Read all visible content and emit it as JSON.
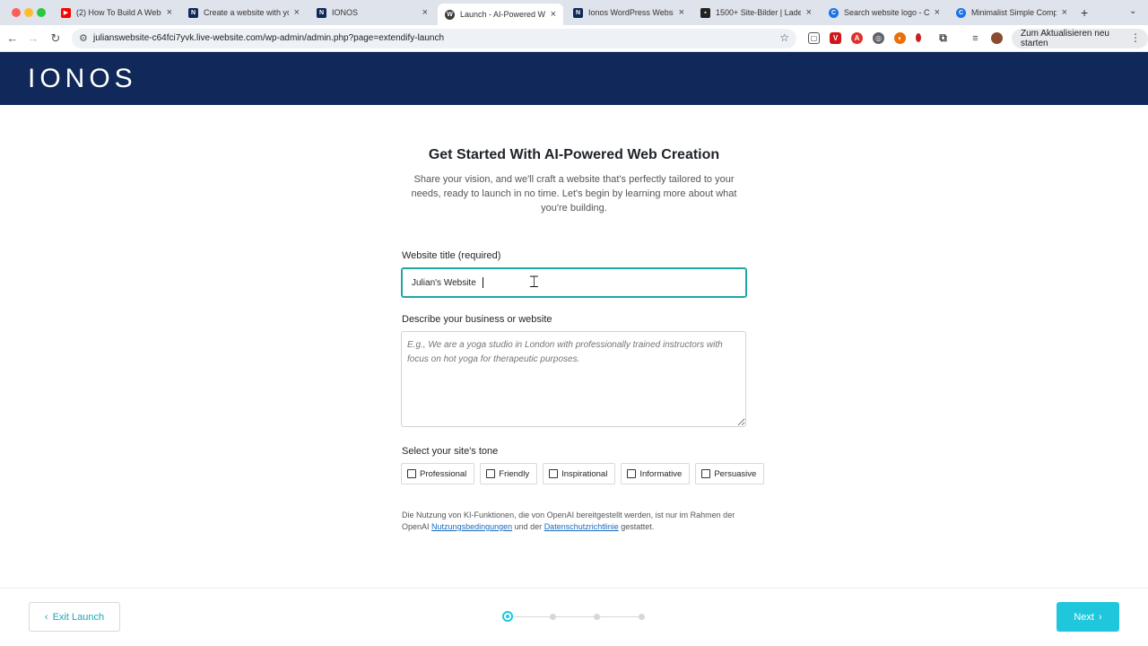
{
  "browser": {
    "tabs": [
      {
        "title": "(2) How To Build A Websi",
        "icon": "youtube-icon",
        "color": "#ff0000"
      },
      {
        "title": "Create a website with yo",
        "icon": "ionos-icon",
        "color": "#11295a"
      },
      {
        "title": "IONOS",
        "icon": "ionos-icon",
        "color": "#11295a"
      },
      {
        "title": "Launch - AI-Powered We",
        "icon": "wordpress-icon",
        "color": "#3c3c3c",
        "active": true
      },
      {
        "title": "Ionos WordPress Website",
        "icon": "ionos-icon",
        "color": "#11295a"
      },
      {
        "title": "1500+ Site-Bilder | Laden",
        "icon": "image-icon",
        "color": "#222222"
      },
      {
        "title": "Search website logo - Ca",
        "icon": "canva-icon",
        "color": "#1a73e8"
      },
      {
        "title": "Minimalist Simple Compu",
        "icon": "canva-icon",
        "color": "#1a73e8"
      }
    ],
    "url": "julianswebsite-c64fci7yvk.live-website.com/wp-admin/admin.php?page=extendify-launch",
    "update_button": "Zum Aktualisieren neu starten"
  },
  "header": {
    "logo": "IONOS",
    "bg_color": "#11295a"
  },
  "main": {
    "title": "Get Started With AI-Powered Web Creation",
    "subtitle": "Share your vision, and we'll craft a website that's perfectly tailored to your needs, ready to launch in no time. Let's begin by learning more about what you're building.",
    "website_title_label": "Website title (required)",
    "website_title_value": "Julian's Website",
    "description_label": "Describe your business or website",
    "description_placeholder": "E.g., We are a yoga studio in London with professionally trained instructors with focus on hot yoga for therapeutic purposes.",
    "tone_label": "Select your site's tone",
    "tones": [
      "Professional",
      "Friendly",
      "Inspirational",
      "Informative",
      "Persuasive"
    ],
    "legal_prefix": "Die Nutzung von KI-Funktionen, die von OpenAI bereitgestellt werden, ist nur im Rahmen der OpenAI",
    "legal_link_terms": "Nutzungsbedingungen",
    "legal_middle": "und der",
    "legal_link_privacy": "Datenschutzrichtlinie",
    "legal_suffix": "gestattet."
  },
  "footer": {
    "exit_label": "Exit Launch",
    "next_label": "Next",
    "steps_total": 4,
    "steps_current": 1,
    "accent_color": "#1fc7dc"
  }
}
